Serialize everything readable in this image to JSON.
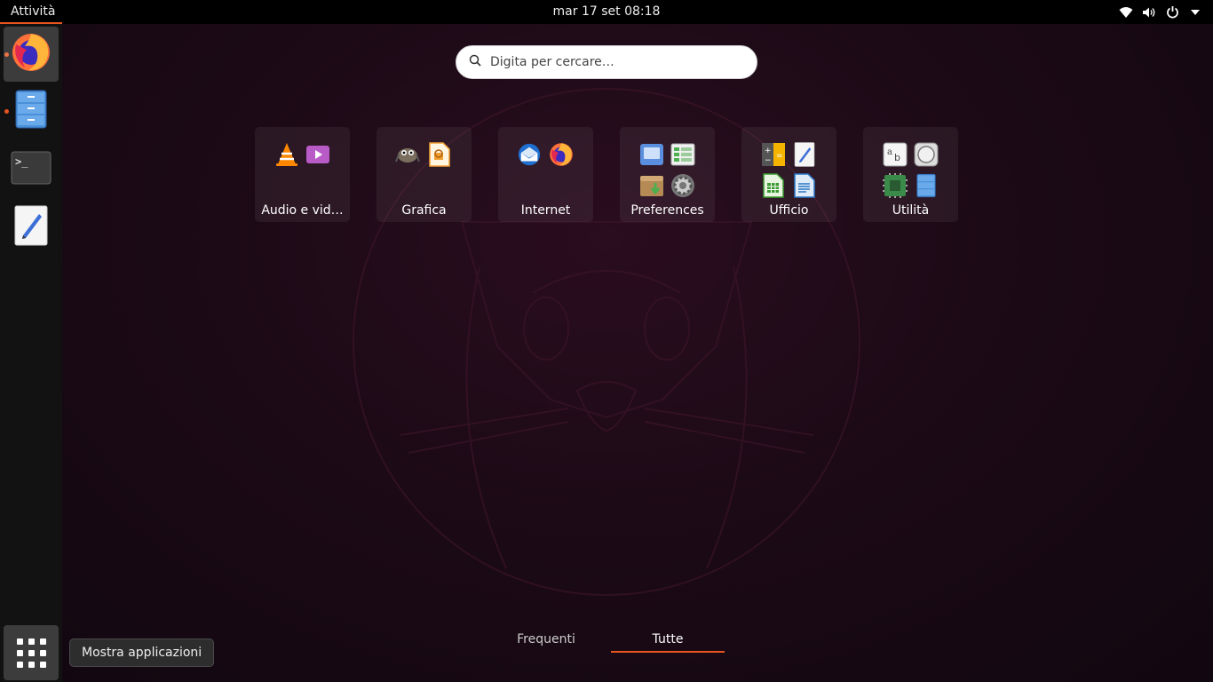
{
  "topbar": {
    "activities_label": "Attività",
    "clock": "mar 17 set  08:18",
    "icons": [
      "wifi-icon",
      "volume-icon",
      "power-icon",
      "chevron-down-icon"
    ]
  },
  "dock": {
    "items": [
      {
        "name": "firefox",
        "icon": "firefox-icon",
        "running": true,
        "active": true
      },
      {
        "name": "files",
        "icon": "files-icon",
        "running": true,
        "active": false
      },
      {
        "name": "terminal",
        "icon": "terminal-icon",
        "running": false,
        "active": false
      },
      {
        "name": "text-editor",
        "icon": "text-editor-icon",
        "running": false,
        "active": false
      }
    ],
    "show_apps_tooltip": "Mostra applicazioni"
  },
  "search": {
    "placeholder": "Digita per cercare…",
    "value": ""
  },
  "folders": [
    {
      "label": "Audio e vid…",
      "icons": [
        "vlc-icon",
        "video-player-icon"
      ]
    },
    {
      "label": "Grafica",
      "icons": [
        "gimp-icon",
        "libreoffice-draw-icon"
      ]
    },
    {
      "label": "Internet",
      "icons": [
        "thunderbird-icon",
        "firefox-icon"
      ]
    },
    {
      "label": "Preferences",
      "icons": [
        "display-settings-icon",
        "tweaks-icon",
        "software-install-icon",
        "settings-gear-icon"
      ]
    },
    {
      "label": "Ufficio",
      "icons": [
        "calculator-icon",
        "text-editor-icon",
        "calc-spreadsheet-icon",
        "writer-document-icon"
      ]
    },
    {
      "label": "Utilità",
      "icons": [
        "font-viewer-icon",
        "disk-usage-icon",
        "system-monitor-icon",
        "files-icon"
      ]
    }
  ],
  "tabs": {
    "frequent": "Frequenti",
    "all": "Tutte",
    "selected": "all"
  },
  "colors": {
    "accent": "#e95420",
    "topbar": "#000000",
    "dock": "#141414",
    "background": "#1c0a16"
  }
}
